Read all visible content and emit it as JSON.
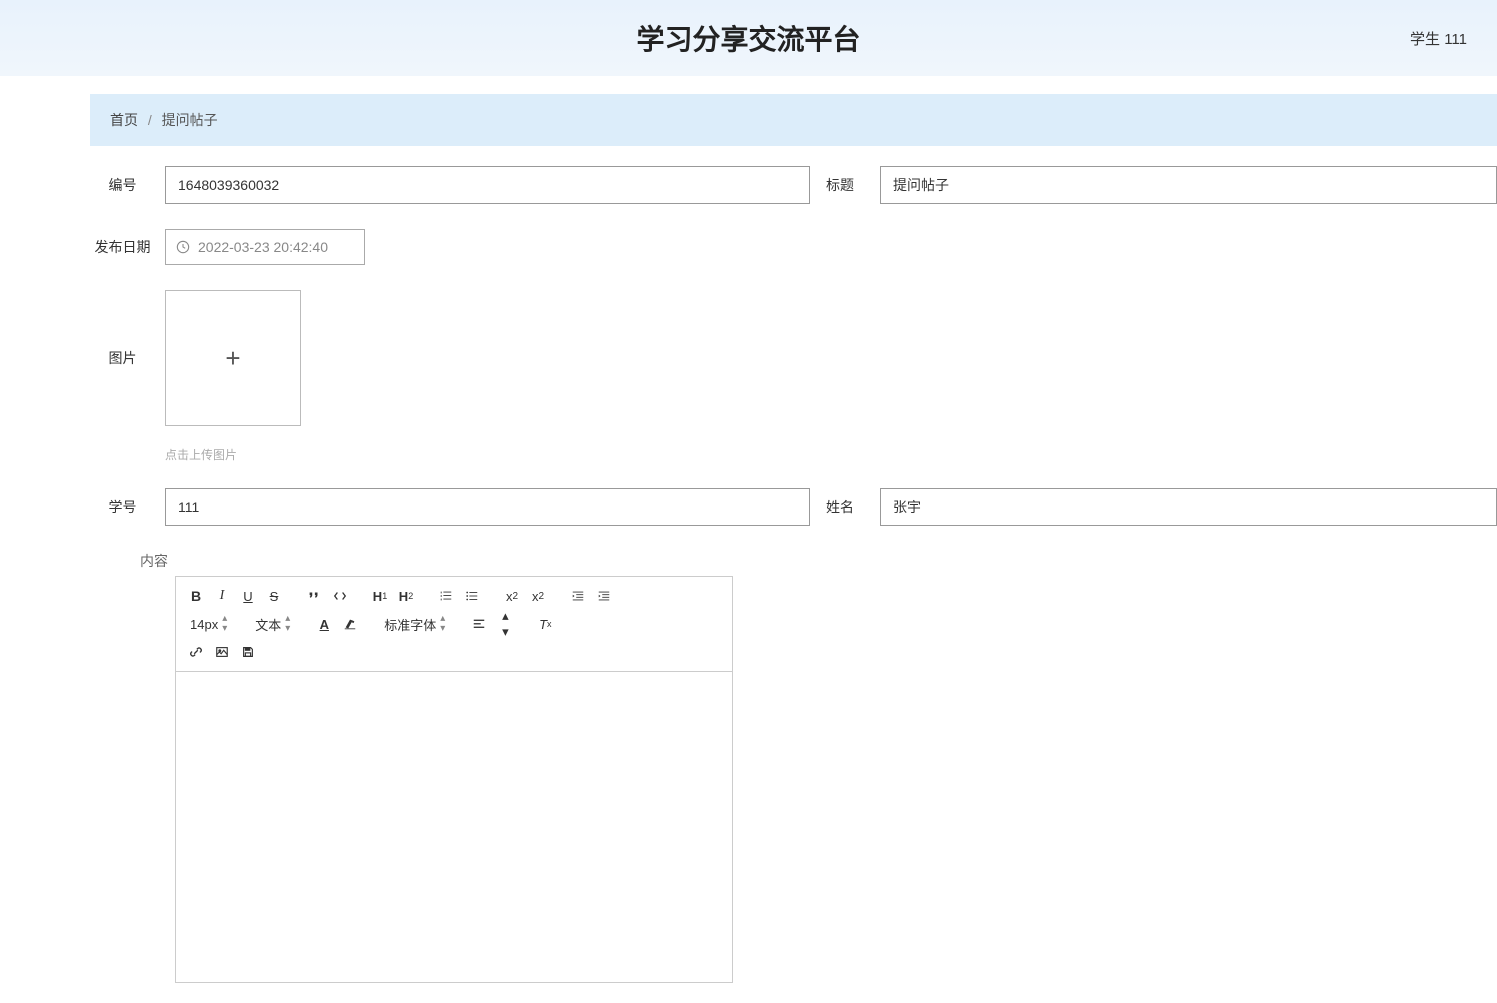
{
  "header": {
    "title": "学习分享交流平台",
    "user": "学生 111"
  },
  "breadcrumb": {
    "home": "首页",
    "current": "提问帖子"
  },
  "form": {
    "id_label": "编号",
    "id_value": "1648039360032",
    "title_label": "标题",
    "title_value": "提问帖子",
    "date_label": "发布日期",
    "date_value": "2022-03-23 20:42:40",
    "image_label": "图片",
    "upload_hint": "点击上传图片",
    "student_id_label": "学号",
    "student_id_value": "111",
    "name_label": "姓名",
    "name_value": "张宇",
    "content_label": "内容"
  },
  "editor": {
    "font_size": "14px",
    "text_label": "文本",
    "font_family": "标准字体"
  }
}
